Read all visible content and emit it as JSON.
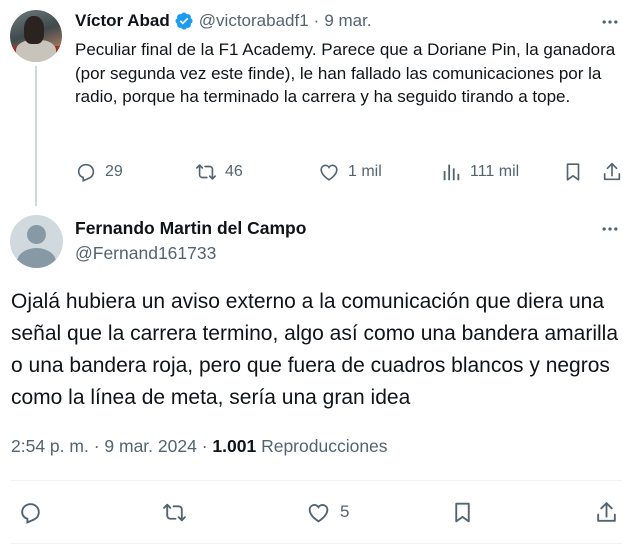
{
  "parent_tweet": {
    "author_name": "Víctor Abad",
    "handle": "@victorabadf1",
    "separator": "·",
    "date": "9 mar.",
    "text": "Peculiar final de la F1 Academy. Parece que a Doriane Pin, la ganadora (por segunda vez este finde), le han fallado las comunicaciones por la radio, porque ha terminado la carrera y ha seguido tirando a tope.",
    "stats": {
      "replies": "29",
      "reposts": "46",
      "likes": "1 mil",
      "views": "111 mil"
    }
  },
  "reply_tweet": {
    "author_name": "Fernando Martin del Campo",
    "handle": "@Fernand161733",
    "text": "Ojalá hubiera un aviso externo a la comunicación que diera una señal que la carrera termino, algo así como una bandera amarilla o una bandera roja, pero que fuera de cuadros blancos y negros como la línea de meta, sería una gran idea",
    "time": "2:54 p. m.",
    "separator": "·",
    "date": "9 mar. 2024",
    "views_count": "1.001",
    "views_label": "Reproducciones",
    "stats": {
      "likes": "5"
    }
  },
  "colors": {
    "text_primary": "#0f1419",
    "text_secondary": "#536471",
    "verified_blue": "#1d9bf0",
    "divider": "#eff3f4"
  },
  "icons": [
    "more-icon",
    "verified-badge-icon",
    "reply-icon",
    "repost-icon",
    "like-icon",
    "views-icon",
    "bookmark-icon",
    "share-icon"
  ]
}
